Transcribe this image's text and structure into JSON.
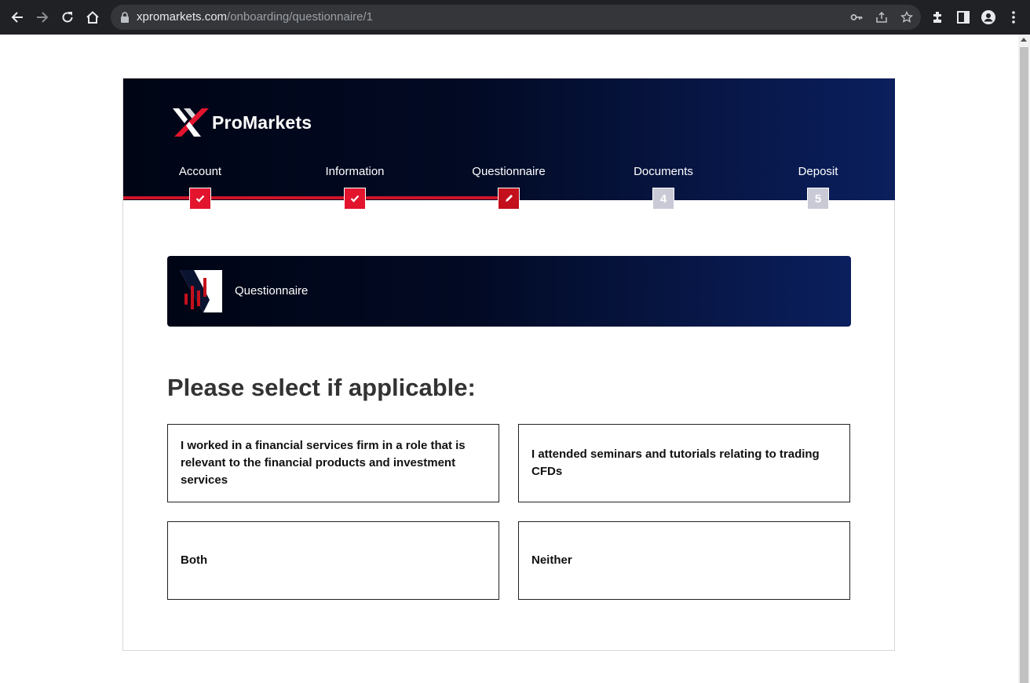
{
  "browser": {
    "url_domain": "xpromarkets.com",
    "url_path": "/onboarding/questionnaire/1"
  },
  "brand": {
    "name": "ProMarkets"
  },
  "steps": [
    {
      "label": "Account",
      "state": "done",
      "marker": ""
    },
    {
      "label": "Information",
      "state": "done",
      "marker": ""
    },
    {
      "label": "Questionnaire",
      "state": "current",
      "marker": ""
    },
    {
      "label": "Documents",
      "state": "todo",
      "marker": "4"
    },
    {
      "label": "Deposit",
      "state": "todo",
      "marker": "5"
    }
  ],
  "section": {
    "title": "Questionnaire"
  },
  "question": {
    "heading": "Please select if applicable:",
    "options": [
      "I worked in a financial services firm in a role that is relevant to the financial products and investment services",
      "I attended seminars and tutorials relating to trading CFDs",
      "Both",
      "Neither"
    ]
  },
  "colors": {
    "accent_red": "#e3142e",
    "navy_dark": "#000515",
    "navy_light": "#0b1f5e",
    "step_inactive": "#c9cad6"
  }
}
